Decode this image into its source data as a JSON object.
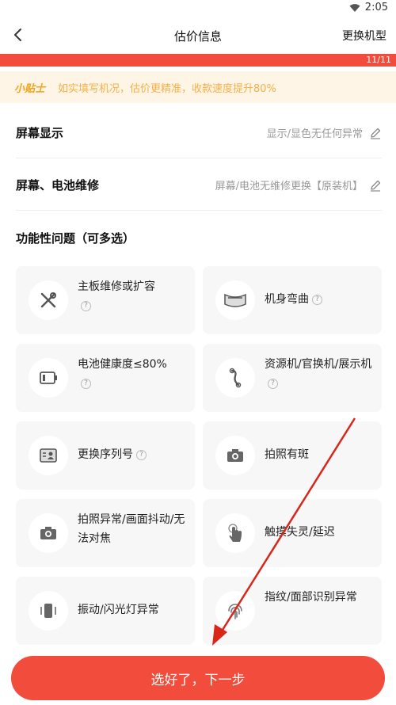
{
  "status": {
    "time": "2:05"
  },
  "nav": {
    "title": "估价信息",
    "action": "更换机型"
  },
  "progress": {
    "label": "11/11",
    "fraction": 1.0,
    "color": "#f14c3c"
  },
  "tip": {
    "tag": "小贴士",
    "text": "如实填写机况，估价更精准，收款速度提升80%"
  },
  "rows": [
    {
      "label": "屏幕显示",
      "value": "显示/显色无任何异常"
    },
    {
      "label": "屏幕、电池维修",
      "value": "屏幕/电池无维修更换【原装机】"
    }
  ],
  "section": {
    "title": "功能性问题（可多选）"
  },
  "options": [
    {
      "label": "主板维修或扩容",
      "help": "?",
      "icon": "wrench-screwdriver-icon"
    },
    {
      "label": "机身弯曲",
      "help": "?",
      "icon": "bent-phone-icon"
    },
    {
      "label": "电池健康度≤80%",
      "help": "?",
      "icon": "battery-icon"
    },
    {
      "label": "资源机/官换机/展示机",
      "help": "?",
      "icon": "link-chain-icon"
    },
    {
      "label": "更换序列号",
      "help": "?",
      "icon": "id-card-icon"
    },
    {
      "label": "拍照有斑",
      "help": "",
      "icon": "camera-icon"
    },
    {
      "label": "拍照异常/画面抖动/无法对焦",
      "help": "",
      "icon": "camera-icon"
    },
    {
      "label": "触摸失灵/延迟",
      "help": "",
      "icon": "touch-hand-icon"
    },
    {
      "label": "振动/闪光灯异常",
      "help": "",
      "icon": "vibrate-icon"
    },
    {
      "label": "指纹/面部识别异常",
      "help": "",
      "icon": "fingerprint-icon"
    }
  ],
  "button": {
    "label": "选好了，下一步"
  },
  "colors": {
    "accent": "#f14c3c",
    "tip_text": "#f5a21c",
    "tip_bg": "#fff5e6",
    "card_bg": "#f7f7f7"
  }
}
